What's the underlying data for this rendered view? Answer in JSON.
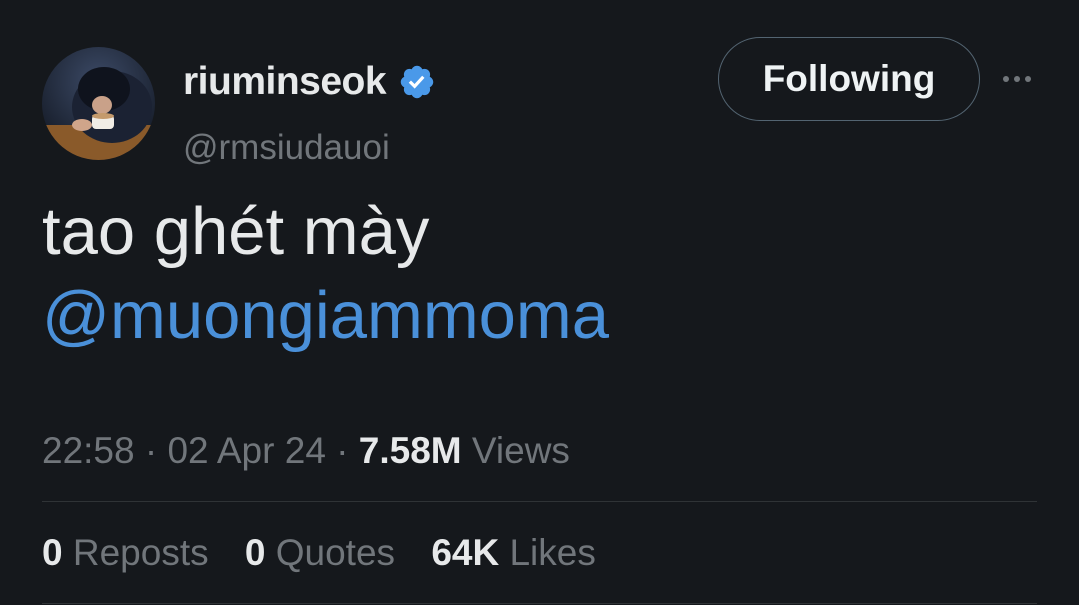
{
  "user": {
    "display_name": "riuminseok",
    "handle": "@rmsiudauoi",
    "verified_color": "#4a99e9"
  },
  "actions": {
    "follow_label": "Following",
    "more_icon": "more-horizontal-icon"
  },
  "tweet": {
    "text": "tao ghét mày",
    "mention": "@muongiammoma"
  },
  "meta": {
    "time": "22:58",
    "separator": "·",
    "date": "02 Apr 24",
    "views_count": "7.58M",
    "views_label": "Views"
  },
  "stats": {
    "reposts_count": "0",
    "reposts_label": "Reposts",
    "quotes_count": "0",
    "quotes_label": "Quotes",
    "likes_count": "64K",
    "likes_label": "Likes"
  },
  "colors": {
    "background": "#15181c",
    "text": "#e7e9ea",
    "muted": "#71767b",
    "link": "#4a90d9"
  }
}
